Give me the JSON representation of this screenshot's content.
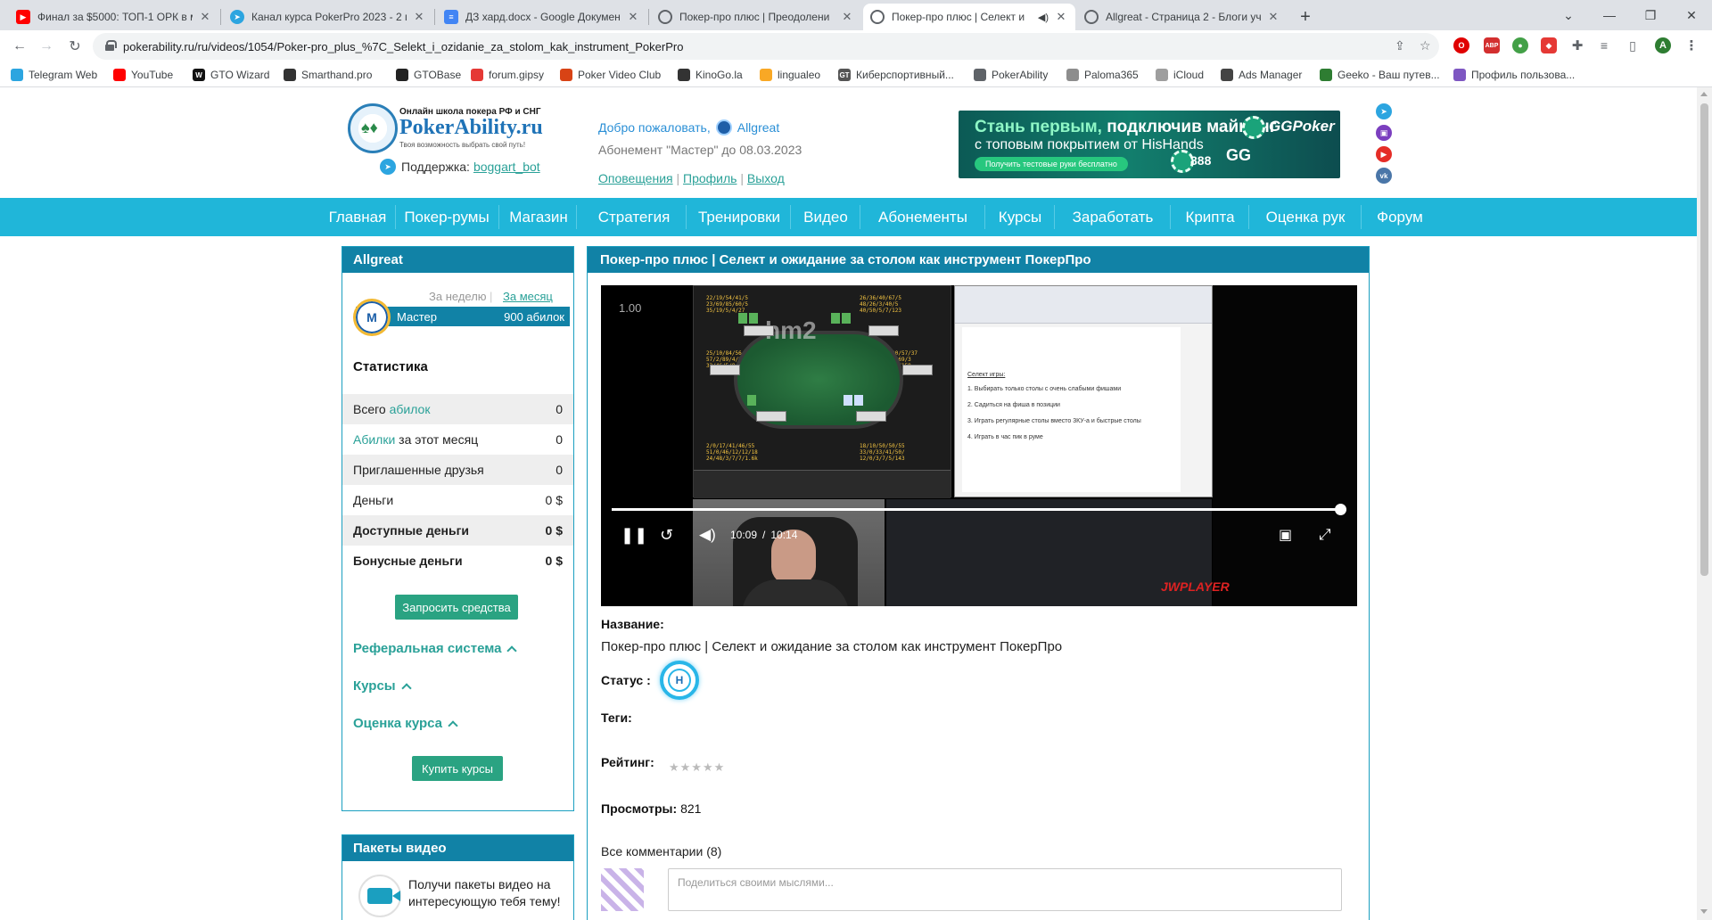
{
  "browser": {
    "tabs": [
      {
        "title": "Финал за $5000: ТОП-1 ОРК в м",
        "favicon_color": "#ff0000",
        "active": false
      },
      {
        "title": "Канал курса PokerPro 2023 - 2 п",
        "favicon_color": "#2ca5e0",
        "active": false
      },
      {
        "title": "ДЗ хард.docx - Google Докумен",
        "favicon_color": "#4285f4",
        "active": false
      },
      {
        "title": "Покер-про плюс | Преодолени",
        "favicon_color": "#5f6368",
        "active": false
      },
      {
        "title": "Покер-про плюс | Селект и",
        "favicon_color": "#5f6368",
        "active": true
      },
      {
        "title": "Allgreat - Страница 2 - Блоги уч",
        "favicon_color": "#5f6368",
        "active": false
      }
    ],
    "url": "pokerability.ru/ru/videos/1054/Poker-pro_plus_%7C_Selekt_i_ozidanie_za_stolom_kak_instrument_PokerPro",
    "profile_initial": "A",
    "bookmarks": [
      {
        "label": "Telegram Web",
        "color": "#2ca5e0"
      },
      {
        "label": "YouTube",
        "color": "#ff0000"
      },
      {
        "label": "GTO Wizard",
        "color": "#111111",
        "glyph": "W"
      },
      {
        "label": "Smarthand.pro",
        "color": "#333333"
      },
      {
        "label": "GTOBase",
        "color": "#222222"
      },
      {
        "label": "forum.gipsy",
        "color": "#e53935"
      },
      {
        "label": "Poker Video Club",
        "color": "#d84315"
      },
      {
        "label": "KinoGo.la",
        "color": "#333333"
      },
      {
        "label": "lingualeo",
        "color": "#f9a825"
      },
      {
        "label": "Киберспортивный...",
        "color": "#555555",
        "glyph": "GT"
      },
      {
        "label": "PokerAbility",
        "color": "#5f6368"
      },
      {
        "label": "Paloma365",
        "color": "#8d8d8d"
      },
      {
        "label": "iCloud",
        "color": "#9e9e9e"
      },
      {
        "label": "Ads Manager",
        "color": "#444444"
      },
      {
        "label": "Geeko - Ваш путев...",
        "color": "#2e7d32"
      },
      {
        "label": "Профиль пользова...",
        "color": "#7e57c2"
      }
    ]
  },
  "header": {
    "logo_top": "Онлайн школа покера РФ и СНГ",
    "logo_main": "PokerAbility.ru",
    "logo_sub": "Твоя возможность выбрать свой путь!",
    "support_label": "Поддержка:",
    "support_link": "boggart_bot",
    "welcome_text": "Добро пожаловать,",
    "username": "Allgreat",
    "subscription": "Абонемент \"Мастер\" до 08.03.2023",
    "links": [
      "Оповещения",
      "Профиль",
      "Выход"
    ],
    "banner": {
      "line1": "Стань первым,",
      "line1b": " подключив майнинг",
      "line2": "с топовым покрытием от HisHands",
      "cta": "Получить тестовые руки бесплатно",
      "brand1": "GGPoker",
      "brand2": "GG",
      "brand3": "888"
    },
    "social": [
      {
        "name": "telegram",
        "color": "#2ca5e0"
      },
      {
        "name": "twitch",
        "color": "#7b3fbf"
      },
      {
        "name": "youtube",
        "color": "#e52d27"
      },
      {
        "name": "vk",
        "color": "#4a76a8"
      }
    ]
  },
  "nav": [
    "Главная",
    "Покер-румы",
    "Магазин",
    "Стратегия",
    "Тренировки",
    "Видео",
    "Абонементы",
    "Курсы",
    "Заработать",
    "Крипта",
    "Оценка рук",
    "Форум"
  ],
  "sidebar": {
    "user_title": "Allgreat",
    "period_week": "За неделю",
    "period_month": "За месяц",
    "rank_letter": "M",
    "rank_name": "Мастер",
    "rank_points": "900 абилок",
    "stats_title": "Статистика",
    "stats": [
      {
        "pre": "Всего ",
        "link": "абилок",
        "post": "",
        "value": "0"
      },
      {
        "pre": "",
        "link": "Абилки",
        "post": " за этот месяц",
        "value": "0"
      },
      {
        "pre": "Приглашенные друзья",
        "link": "",
        "post": "",
        "value": "0"
      },
      {
        "pre": "Деньги",
        "link": "",
        "post": "",
        "value": "0 $"
      },
      {
        "pre": "Доступные деньги",
        "link": "",
        "post": "",
        "value": "0 $"
      },
      {
        "pre": "Бонусные деньги",
        "link": "",
        "post": "",
        "value": "0 $"
      }
    ],
    "request_funds": "Запросить средства",
    "accordions": [
      "Реферальная система",
      "Курсы",
      "Оценка курса"
    ],
    "buy_courses": "Купить курсы",
    "packs_title": "Пакеты видео",
    "packs_text": "Получи пакеты видео на интересующую тебя тему!"
  },
  "content": {
    "title": "Покер-про плюс | Селект и ожидание за столом как инструмент ПокерПро",
    "player": {
      "speed": "1.00",
      "time_current": "10:09",
      "time_total": "10:14",
      "progress": 0.992,
      "brand": "JWPLAYER",
      "doc_lines": [
        "Селект игры:",
        "1. Выбирать только столы с очень слабыми фишами",
        "2. Садиться на фиша в позиции",
        "3. Играть регулярные столы вместо 3КУ-а и быстрые столы",
        "4. Играть в час пик в руме"
      ]
    },
    "name_label": "Название:",
    "name_value": "Покер-про плюс | Селект и ожидание за столом как инструмент ПокерПро",
    "status_label": "Статус :",
    "status_letter": "Н",
    "tags_label": "Теги:",
    "rating_label": "Рейтинг:",
    "rating_stars": "★★★★★",
    "views_label": "Просмотры:",
    "views_value": "821",
    "comments_label": "Все комментарии (8)",
    "comment_placeholder": "Поделиться своими мыслями..."
  }
}
